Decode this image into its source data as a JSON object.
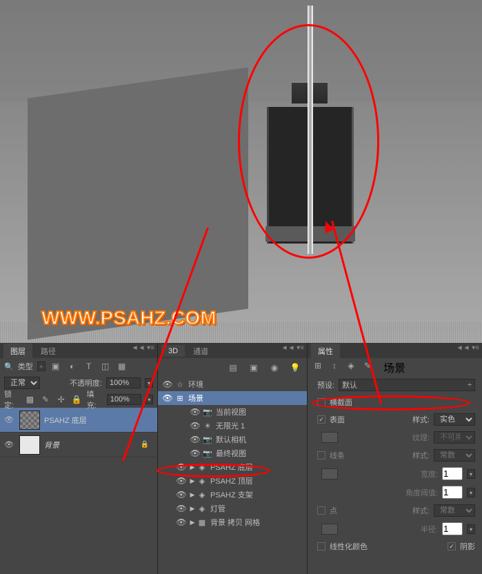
{
  "watermark": "WWW.PSAHZ.COM",
  "layers_panel": {
    "tabs": [
      "图层",
      "路径"
    ],
    "type_label": "类型",
    "blend_mode": "正常",
    "opacity_label": "不透明度:",
    "opacity_value": "100%",
    "lock_label": "锁定:",
    "fill_label": "填充:",
    "fill_value": "100%",
    "layers": [
      {
        "name": "PSAHZ 底层",
        "visible": true,
        "active": true,
        "thumb": "checker"
      },
      {
        "name": "背景",
        "visible": true,
        "active": false,
        "thumb": "solid",
        "locked": true,
        "italic": true
      }
    ]
  },
  "panel_3d": {
    "tabs": [
      "3D",
      "通道"
    ],
    "items": [
      {
        "icon": "env",
        "label": "环境",
        "indent": 0
      },
      {
        "icon": "scene",
        "label": "场景",
        "indent": 0,
        "selected": true
      },
      {
        "icon": "camera",
        "label": "当前视图",
        "indent": 2
      },
      {
        "icon": "light",
        "label": "无限光 1",
        "indent": 2
      },
      {
        "icon": "camera",
        "label": "默认相机",
        "indent": 2
      },
      {
        "icon": "camera",
        "label": "最终视图",
        "indent": 2
      },
      {
        "icon": "mesh",
        "label": "PSAHZ 底层",
        "indent": 1,
        "expand": true
      },
      {
        "icon": "mesh",
        "label": "PSAHZ 顶层",
        "indent": 1,
        "expand": true
      },
      {
        "icon": "mesh",
        "label": "PSAHZ 支架",
        "indent": 1,
        "expand": true
      },
      {
        "icon": "mesh",
        "label": "灯管",
        "indent": 1,
        "expand": true
      },
      {
        "icon": "mesh",
        "label": "背景 拷贝 网格",
        "indent": 1,
        "expand": true
      }
    ]
  },
  "props_panel": {
    "tabs": [
      "属性"
    ],
    "title": "场景",
    "preset_label": "预设:",
    "preset_value": "默认",
    "cross_section": "横截面",
    "surface": "表面",
    "surface_style_label": "样式:",
    "surface_style_value": "实色",
    "texture_label": "纹理:",
    "texture_value": "不可用",
    "lines": "线条",
    "lines_style_label": "样式:",
    "lines_style_value": "常数",
    "width_label": "宽度:",
    "width_value": "1",
    "angle_label": "角度阈值:",
    "angle_value": "1",
    "points": "点",
    "points_style_label": "样式:",
    "points_style_value": "常数",
    "radius_label": "半径:",
    "radius_value": "1",
    "linearize": "线性化颜色",
    "shadow": "阴影"
  }
}
